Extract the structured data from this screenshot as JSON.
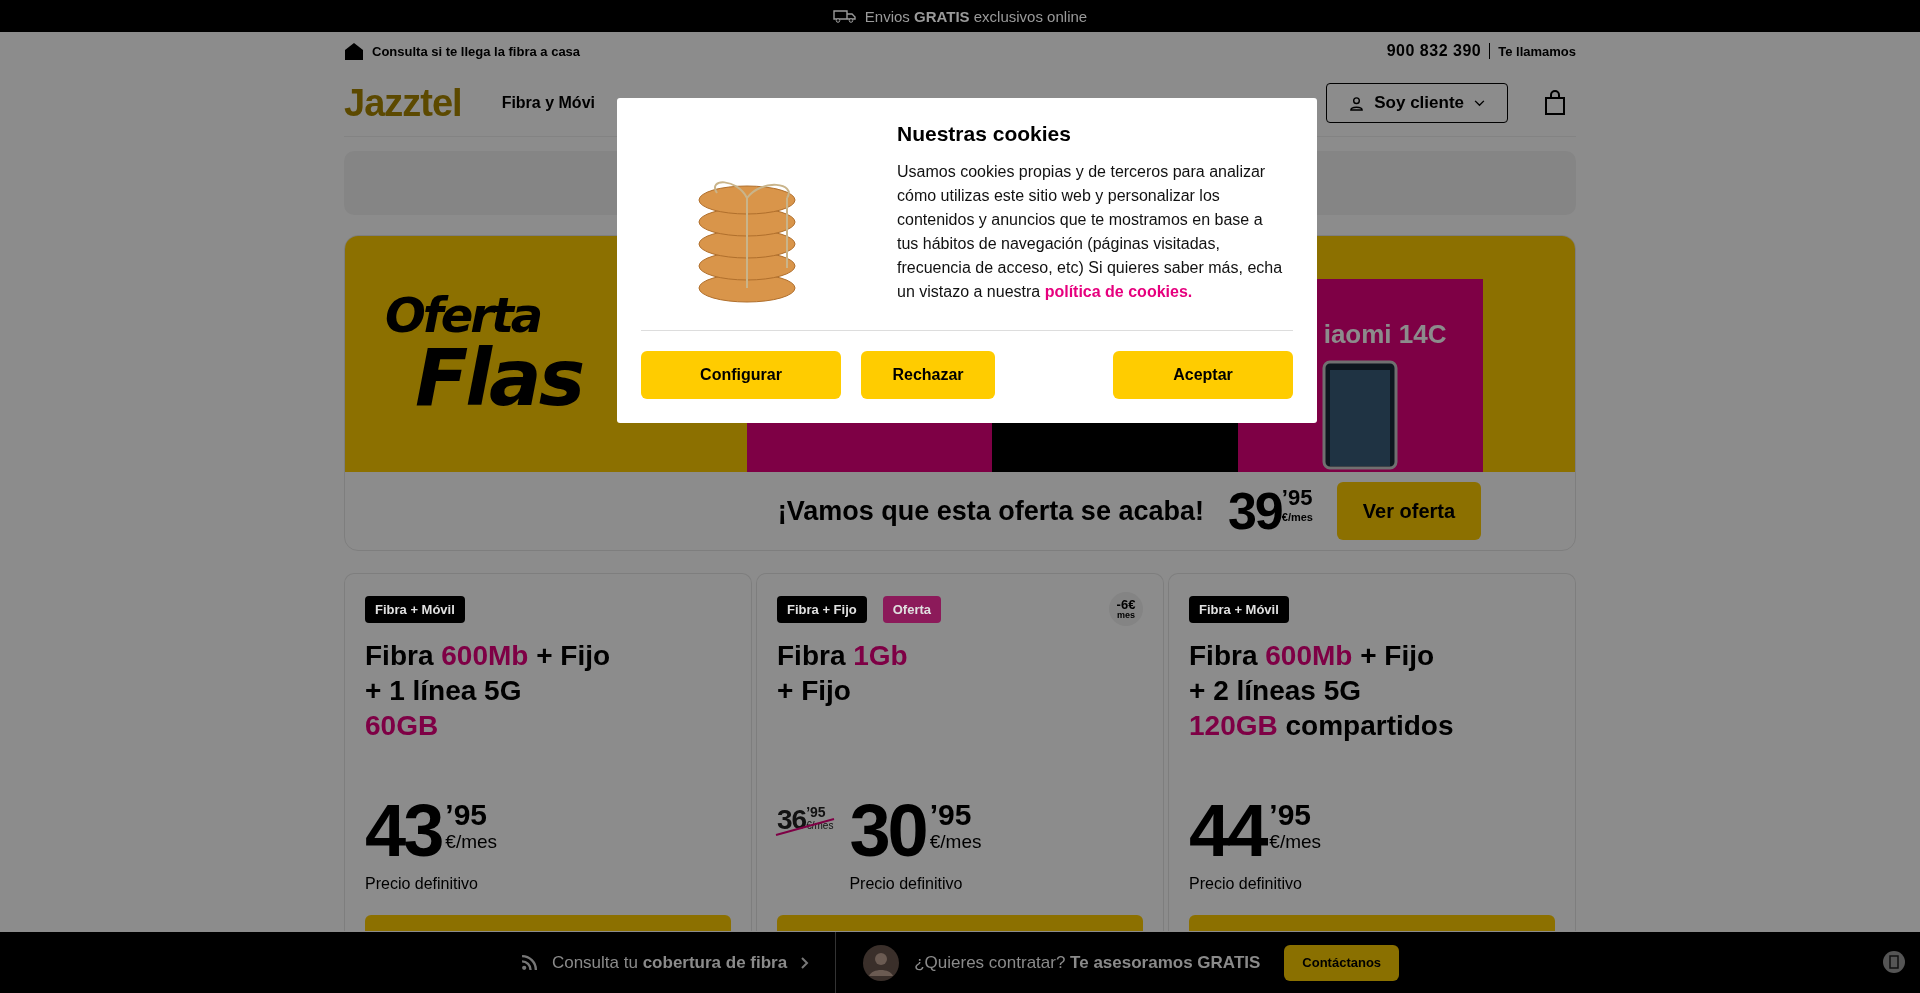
{
  "promo_bar": {
    "text": "Envios **GRATIS** exclusivos online"
  },
  "subheader": {
    "coverage_link": "Consulta si te llega la fibra a casa",
    "phone": "900 832 390",
    "callback_link": "Te llamamos"
  },
  "nav": {
    "logo": "Jazztel",
    "items": [
      "Fibra y Móvi"
    ],
    "client_button": "Soy cliente"
  },
  "banner": {
    "title_lines": [
      "Oferta",
      "Flas"
    ],
    "product": "iaomi 14C",
    "tagline": "¡Vamos que esta oferta se acaba!",
    "price_whole": "39",
    "price_cents": "’95",
    "price_unit": "€/mes",
    "cta": "Ver oferta"
  },
  "cards": [
    {
      "tags": [
        {
          "text": "Fibra + Móvil",
          "color": "#000000"
        }
      ],
      "title_lines": [
        [
          {
            "text": "Fibra ",
            "highlight": false
          },
          {
            "text": "600Mb",
            "highlight": true
          },
          {
            "text": " + Fijo",
            "highlight": false
          }
        ],
        [
          {
            "text": "+ 1 línea 5G",
            "highlight": false
          }
        ],
        [
          {
            "text": "60GB",
            "highlight": true
          }
        ]
      ],
      "price_whole": "43",
      "price_cents": "’95",
      "price_unit": "€/mes",
      "price_note": "Precio definitivo"
    },
    {
      "tags": [
        {
          "text": "Fibra + Fijo",
          "color": "#000000"
        },
        {
          "text": "Oferta",
          "color": "#8c1a5a"
        }
      ],
      "discount": {
        "amount": "-6€",
        "unit": "mes"
      },
      "title_lines": [
        [
          {
            "text": "Fibra ",
            "highlight": false
          },
          {
            "text": "1Gb",
            "highlight": true
          }
        ],
        [
          {
            "text": "+ Fijo",
            "highlight": false
          }
        ]
      ],
      "old_price": {
        "whole": "36",
        "cents": "’95",
        "unit": "€/mes"
      },
      "price_whole": "30",
      "price_cents": "’95",
      "price_unit": "€/mes",
      "price_note": "Precio definitivo"
    },
    {
      "tags": [
        {
          "text": "Fibra + Móvil",
          "color": "#000000"
        }
      ],
      "title_lines": [
        [
          {
            "text": "Fibra ",
            "highlight": false
          },
          {
            "text": "600Mb",
            "highlight": true
          },
          {
            "text": " + Fijo",
            "highlight": false
          }
        ],
        [
          {
            "text": "+ 2 líneas 5G",
            "highlight": false
          }
        ],
        [
          {
            "text": "120GB",
            "highlight": true
          },
          {
            "text": " compartidos",
            "highlight": false
          }
        ]
      ],
      "price_whole": "44",
      "price_cents": "’95",
      "price_unit": "€/mes",
      "price_note": "Precio definitivo"
    }
  ],
  "bottom_bar": {
    "coverage": "Consulta tu **cobertura de fibra**",
    "question": "¿Quieres contratar? **Te asesoramos GRATIS**",
    "contact_button": "Contáctanos"
  },
  "cookie_dialog": {
    "title": "Nuestras cookies",
    "body": "Usamos cookies propias y de terceros para analizar cómo utilizas este sitio web y personalizar los contenidos y anuncios que te mostramos en base a tus hábitos de navegación (páginas visitadas, frecuencia de acceso, etc) Si quieres saber más, echa un vistazo a nuestra",
    "policy_link": "política de cookies.",
    "buttons": [
      "Configurar",
      "Rechazar",
      "Aceptar"
    ]
  }
}
